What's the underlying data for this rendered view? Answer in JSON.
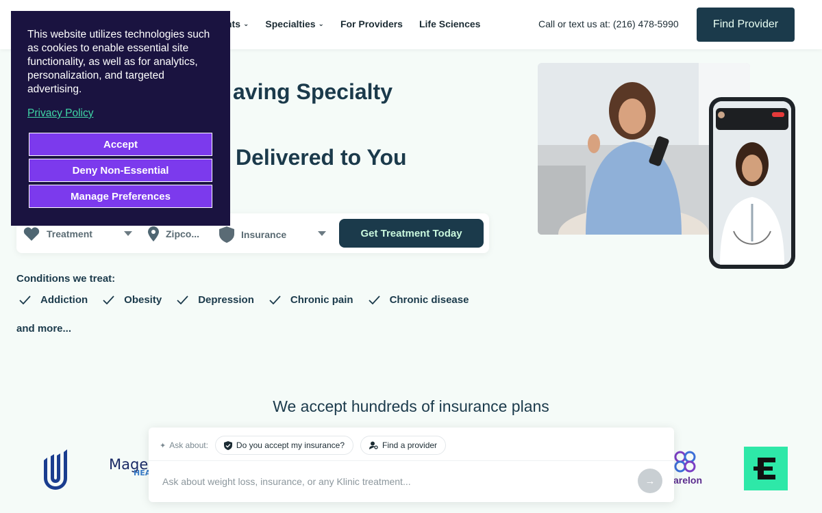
{
  "header": {
    "nav": [
      {
        "label": "Treatments",
        "has_dropdown": true
      },
      {
        "label": "Specialties",
        "has_dropdown": true
      },
      {
        "label": "For Providers",
        "has_dropdown": false
      },
      {
        "label": "Life Sciences",
        "has_dropdown": false
      }
    ],
    "nav_visible_fragment": "nts",
    "call_text": "Call or text us at: (216) 478-5990",
    "find_provider": "Find Provider"
  },
  "hero": {
    "line1": "aving Specialty",
    "line2": "Delivered to You"
  },
  "search": {
    "treatment": "Treatment",
    "zipcode": "Zipco...",
    "insurance": "Insurance",
    "cta": "Get Treatment Today"
  },
  "conditions": {
    "title": "Conditions we treat:",
    "items": [
      "Addiction",
      "Obesity",
      "Depression",
      "Chronic pain",
      "Chronic disease"
    ],
    "more": "and more..."
  },
  "insurance": {
    "title": "We accept hundreds of insurance plans",
    "logos": {
      "magellan": "Magella",
      "magellan_sub": "HEA",
      "carelon": "arelon"
    }
  },
  "chat": {
    "ask_label": "Ask about:",
    "chips": [
      "Do you accept my insurance?",
      "Find a provider"
    ],
    "placeholder": "Ask about weight loss, insurance, or any Klinic treatment..."
  },
  "cookie": {
    "text": "This website utilizes technologies such as cookies to enable essential site functionality, as well as for analytics, personalization, and targeted advertising.",
    "privacy_link": "Privacy Policy",
    "accept": "Accept",
    "deny": "Deny Non-Essential",
    "manage": "Manage Preferences"
  },
  "colors": {
    "primary": "#1b3a4b",
    "accent_green": "#3fd7a6",
    "cookie_bg": "#1a1340",
    "cookie_button": "#7c3aed"
  }
}
